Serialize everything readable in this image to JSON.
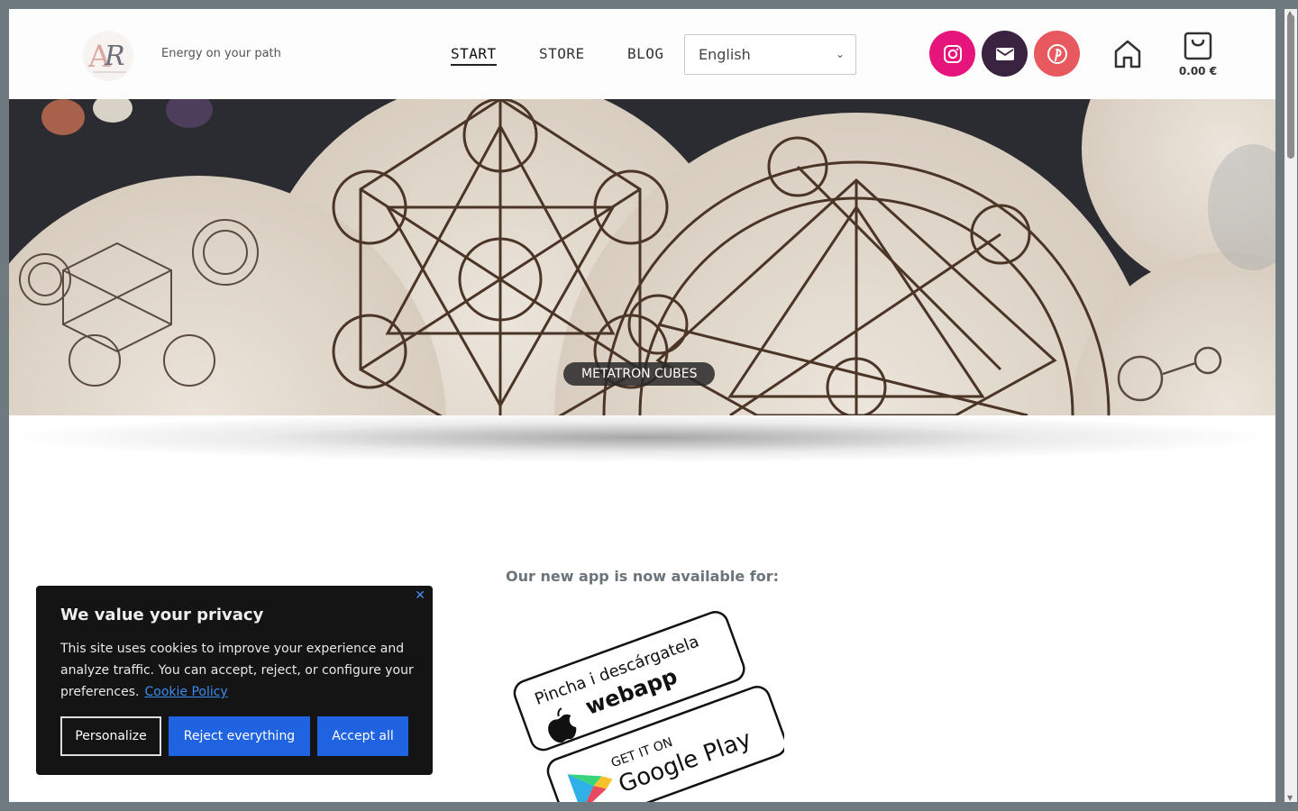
{
  "header": {
    "tagline": "Energy on your path",
    "nav": [
      {
        "label": "START"
      },
      {
        "label": "STORE"
      },
      {
        "label": "BLOG"
      }
    ],
    "language": {
      "selected": "English"
    },
    "cart_total": "0.00 €"
  },
  "hero": {
    "caption": "METATRON CUBES"
  },
  "main": {
    "app_heading": "Our new app is now available for:",
    "badges": {
      "webapp_line1": "Pincha i descárgatela",
      "webapp_line2": "webapp",
      "play_line1": "GET IT ON",
      "play_line2": "Google Play"
    }
  },
  "cookie": {
    "title": "We value your privacy",
    "text": "This site uses cookies to improve your experience and analyze traffic. You can accept, reject, or configure your preferences.",
    "link": "Cookie Policy",
    "buttons": {
      "personalize": "Personalize",
      "reject": "Reject everything",
      "accept": "Accept all"
    }
  },
  "colors": {
    "instagram": "#e6157b",
    "mail": "#3a2340",
    "pinterest": "#e8585f",
    "accent_blue": "#1f63e0",
    "frame": "#6e7a80"
  },
  "icons": [
    "instagram-icon",
    "mail-icon",
    "pinterest-icon",
    "home-icon",
    "shopping-bag-icon",
    "chevron-down-icon",
    "close-icon",
    "apple-icon",
    "google-play-icon"
  ]
}
